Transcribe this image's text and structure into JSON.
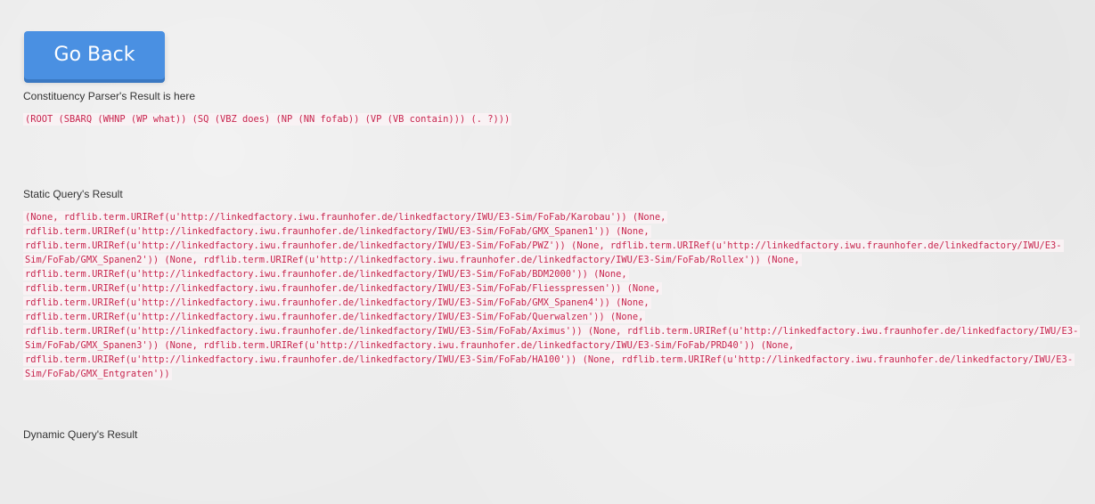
{
  "go_back": {
    "label": "Go Back"
  },
  "constituency": {
    "title": "Constituency Parser's Result is here",
    "result": "(ROOT (SBARQ (WHNP (WP what)) (SQ (VBZ does) (NP (NN fofab)) (VP (VB contain))) (. ?)))"
  },
  "static_query": {
    "title": "Static Query's Result",
    "result": "(None, rdflib.term.URIRef(u'http://linkedfactory.iwu.fraunhofer.de/linkedfactory/IWU/E3-Sim/FoFab/Karobau')) (None, rdflib.term.URIRef(u'http://linkedfactory.iwu.fraunhofer.de/linkedfactory/IWU/E3-Sim/FoFab/GMX_Spanen1')) (None, rdflib.term.URIRef(u'http://linkedfactory.iwu.fraunhofer.de/linkedfactory/IWU/E3-Sim/FoFab/PWZ')) (None, rdflib.term.URIRef(u'http://linkedfactory.iwu.fraunhofer.de/linkedfactory/IWU/E3-Sim/FoFab/GMX_Spanen2')) (None, rdflib.term.URIRef(u'http://linkedfactory.iwu.fraunhofer.de/linkedfactory/IWU/E3-Sim/FoFab/Rollex')) (None, rdflib.term.URIRef(u'http://linkedfactory.iwu.fraunhofer.de/linkedfactory/IWU/E3-Sim/FoFab/BDM2000')) (None, rdflib.term.URIRef(u'http://linkedfactory.iwu.fraunhofer.de/linkedfactory/IWU/E3-Sim/FoFab/Fliesspressen')) (None, rdflib.term.URIRef(u'http://linkedfactory.iwu.fraunhofer.de/linkedfactory/IWU/E3-Sim/FoFab/GMX_Spanen4')) (None, rdflib.term.URIRef(u'http://linkedfactory.iwu.fraunhofer.de/linkedfactory/IWU/E3-Sim/FoFab/Querwalzen')) (None, rdflib.term.URIRef(u'http://linkedfactory.iwu.fraunhofer.de/linkedfactory/IWU/E3-Sim/FoFab/Aximus')) (None, rdflib.term.URIRef(u'http://linkedfactory.iwu.fraunhofer.de/linkedfactory/IWU/E3-Sim/FoFab/GMX_Spanen3')) (None, rdflib.term.URIRef(u'http://linkedfactory.iwu.fraunhofer.de/linkedfactory/IWU/E3-Sim/FoFab/PRD40')) (None, rdflib.term.URIRef(u'http://linkedfactory.iwu.fraunhofer.de/linkedfactory/IWU/E3-Sim/FoFab/HA100')) (None, rdflib.term.URIRef(u'http://linkedfactory.iwu.fraunhofer.de/linkedfactory/IWU/E3-Sim/FoFab/GMX_Entgraten'))"
  },
  "dynamic_query": {
    "title": "Dynamic Query's Result"
  }
}
